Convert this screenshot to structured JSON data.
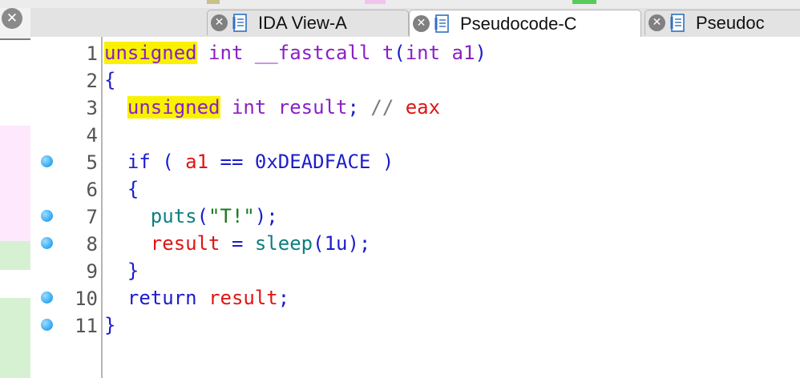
{
  "tabs": [
    {
      "label": "IDA View-A",
      "active": false
    },
    {
      "label": "Pseudocode-C",
      "active": true
    },
    {
      "label": "Pseudoc",
      "active": false
    }
  ],
  "icons": {
    "close": "close-icon",
    "document": "document-icon"
  },
  "colors": {
    "keyword": "#1c1ccc",
    "type": "#8b1fc6",
    "highlight": "#f8f200",
    "variable": "#e01414",
    "function": "#0e7f7f",
    "string": "#1a7a1a",
    "comment": "#7a7a7a",
    "breakpoint": "#2ea6f1"
  },
  "code": {
    "lines": [
      {
        "num": "1",
        "breakpoint": false,
        "tokens": [
          {
            "t": "unsigned",
            "c": "typ hl"
          },
          {
            "t": " ",
            "c": ""
          },
          {
            "t": "int",
            "c": "typ"
          },
          {
            "t": " ",
            "c": ""
          },
          {
            "t": "__fastcall",
            "c": "typ"
          },
          {
            "t": " ",
            "c": ""
          },
          {
            "t": "t",
            "c": "typ"
          },
          {
            "t": "(",
            "c": "punc"
          },
          {
            "t": "int",
            "c": "typ"
          },
          {
            "t": " ",
            "c": ""
          },
          {
            "t": "a1",
            "c": "typ"
          },
          {
            "t": ")",
            "c": "punc"
          }
        ]
      },
      {
        "num": "2",
        "breakpoint": false,
        "tokens": [
          {
            "t": "{",
            "c": "punc"
          }
        ]
      },
      {
        "num": "3",
        "breakpoint": false,
        "tokens": [
          {
            "t": "  ",
            "c": ""
          },
          {
            "t": "unsigned",
            "c": "typ hl"
          },
          {
            "t": " ",
            "c": ""
          },
          {
            "t": "int",
            "c": "typ"
          },
          {
            "t": " ",
            "c": ""
          },
          {
            "t": "result",
            "c": "typ"
          },
          {
            "t": "; ",
            "c": "punc"
          },
          {
            "t": "// ",
            "c": "cmt"
          },
          {
            "t": "eax",
            "c": "var"
          }
        ]
      },
      {
        "num": "4",
        "breakpoint": false,
        "tokens": []
      },
      {
        "num": "5",
        "breakpoint": true,
        "tokens": [
          {
            "t": "  ",
            "c": ""
          },
          {
            "t": "if",
            "c": "kw"
          },
          {
            "t": " ( ",
            "c": "punc"
          },
          {
            "t": "a1",
            "c": "var"
          },
          {
            "t": " == ",
            "c": "punc"
          },
          {
            "t": "0xDEADFACE",
            "c": "num"
          },
          {
            "t": " )",
            "c": "punc"
          }
        ]
      },
      {
        "num": "6",
        "breakpoint": false,
        "tokens": [
          {
            "t": "  {",
            "c": "punc"
          }
        ]
      },
      {
        "num": "7",
        "breakpoint": true,
        "tokens": [
          {
            "t": "    ",
            "c": ""
          },
          {
            "t": "puts",
            "c": "fn"
          },
          {
            "t": "(",
            "c": "punc"
          },
          {
            "t": "\"T!\"",
            "c": "str"
          },
          {
            "t": ");",
            "c": "punc"
          }
        ]
      },
      {
        "num": "8",
        "breakpoint": true,
        "tokens": [
          {
            "t": "    ",
            "c": ""
          },
          {
            "t": "result",
            "c": "var"
          },
          {
            "t": " = ",
            "c": "punc"
          },
          {
            "t": "sleep",
            "c": "fn"
          },
          {
            "t": "(",
            "c": "punc"
          },
          {
            "t": "1u",
            "c": "num"
          },
          {
            "t": ");",
            "c": "punc"
          }
        ]
      },
      {
        "num": "9",
        "breakpoint": false,
        "tokens": [
          {
            "t": "  }",
            "c": "punc"
          }
        ]
      },
      {
        "num": "10",
        "breakpoint": true,
        "tokens": [
          {
            "t": "  ",
            "c": ""
          },
          {
            "t": "return",
            "c": "kw"
          },
          {
            "t": " ",
            "c": ""
          },
          {
            "t": "result",
            "c": "var"
          },
          {
            "t": ";",
            "c": "punc"
          }
        ]
      },
      {
        "num": "11",
        "breakpoint": true,
        "tokens": [
          {
            "t": "}",
            "c": "punc"
          }
        ]
      }
    ]
  }
}
